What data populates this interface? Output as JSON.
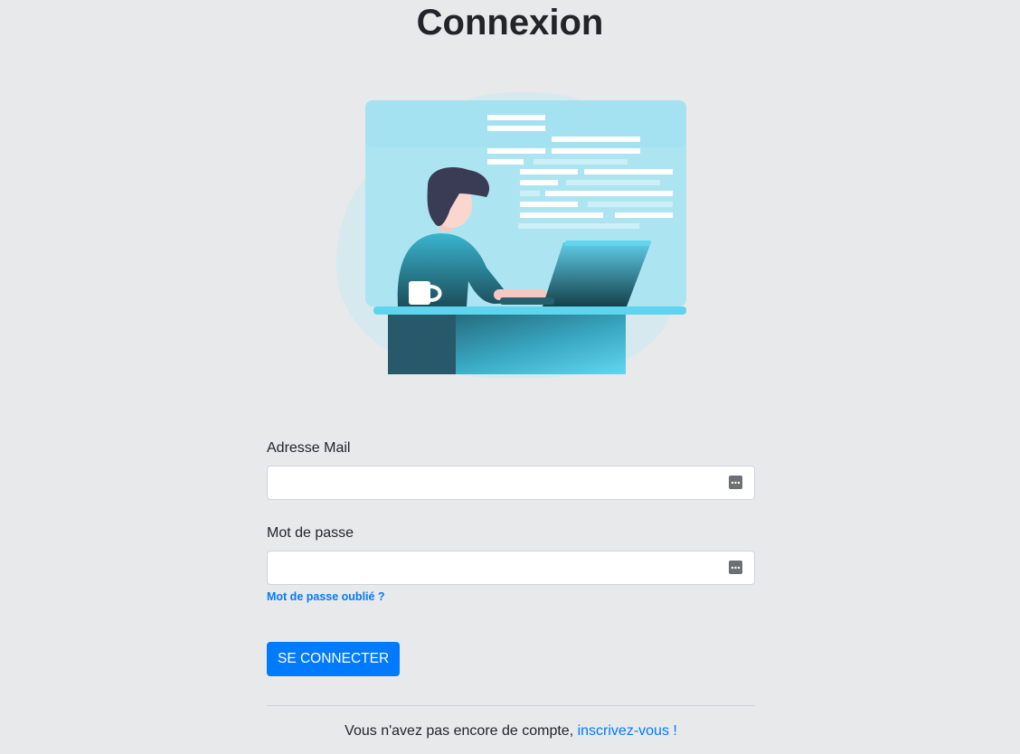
{
  "page": {
    "title": "Connexion"
  },
  "form": {
    "email_label": "Adresse Mail",
    "email_value": "",
    "password_label": "Mot de passe",
    "password_value": "",
    "forgot_password": "Mot de passe oublié ?",
    "submit_label": "SE CONNECTER"
  },
  "footer": {
    "no_account_text": "Vous n'avez pas encore de compte, ",
    "signup_link": "inscrivez-vous !"
  },
  "colors": {
    "background": "#e8e9eb",
    "primary": "#007bff",
    "text": "#212529"
  },
  "icons": {
    "field_icon": "keyboard-icon",
    "illustration": "person-at-laptop-illustration"
  }
}
